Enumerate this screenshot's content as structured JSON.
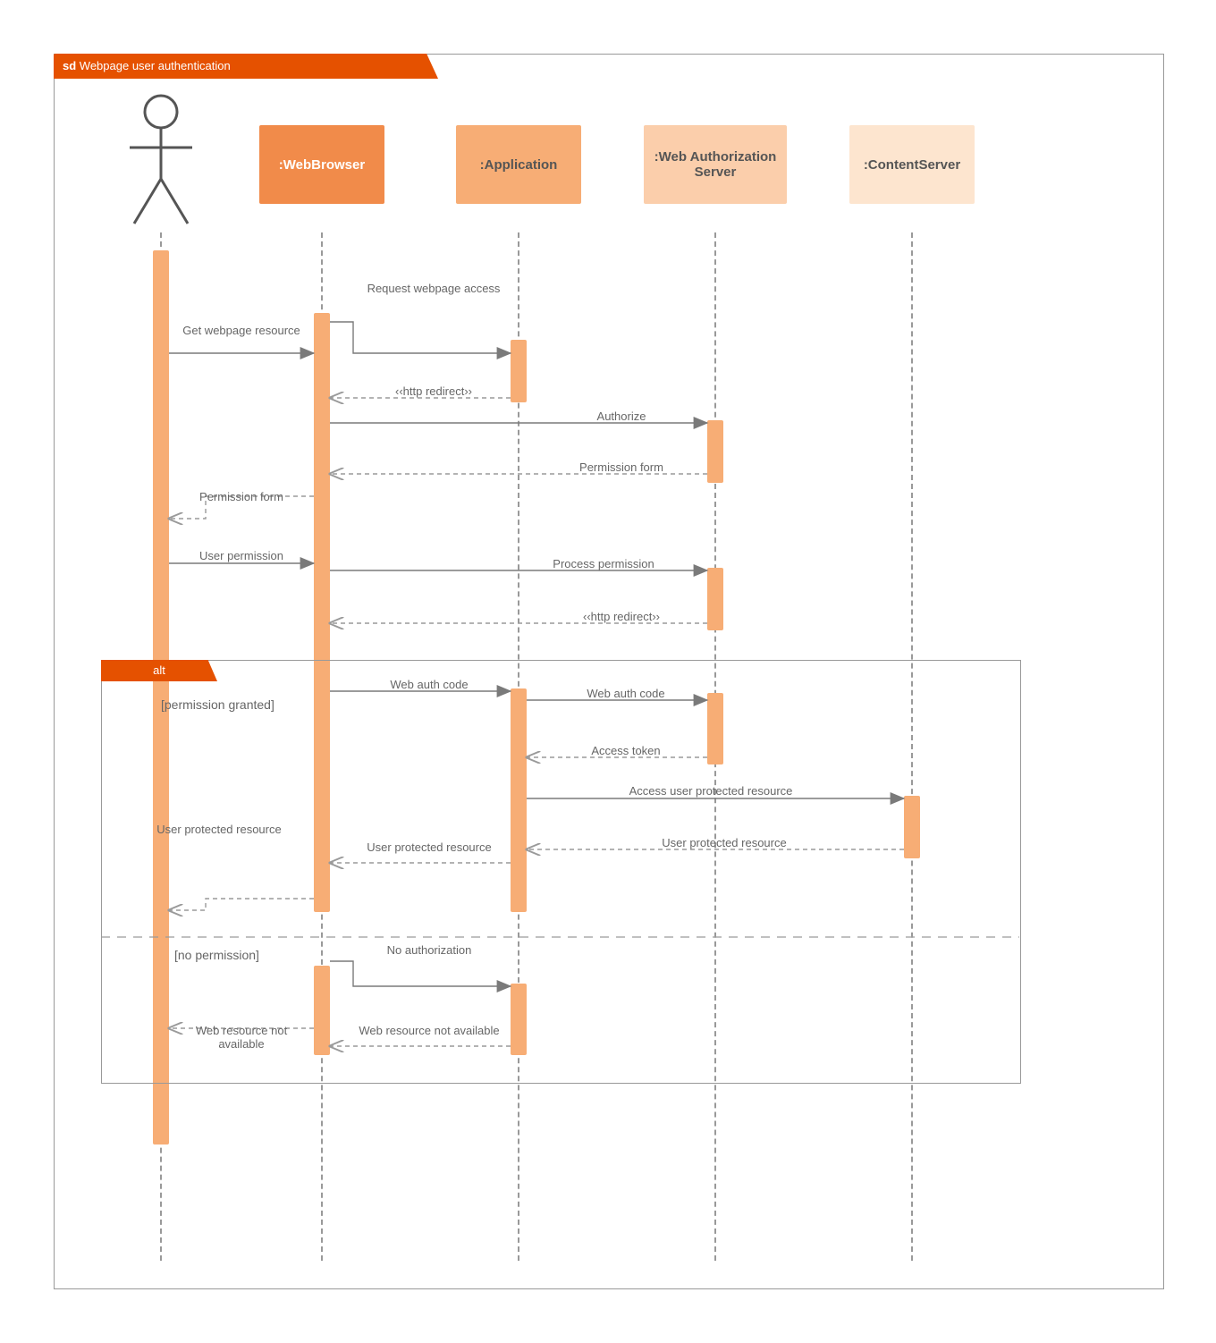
{
  "frame": {
    "stereo": "sd",
    "title": "Webpage user authentication"
  },
  "participants": {
    "actor": "User",
    "p1": ":WebBrowser",
    "p2": ":Application",
    "p3": ":Web Authorization Server",
    "p4": ":ContentServer"
  },
  "lifeline_x": {
    "actor": 180,
    "p1": 360,
    "p2": 580,
    "p3": 800,
    "p4": 1020
  },
  "messages": {
    "m1": {
      "from": "actor",
      "to": "p1",
      "text": "Get webpage resource",
      "type": "sync"
    },
    "m2": {
      "from": "p1",
      "to": "p2",
      "text": "Request webpage access",
      "type": "sync"
    },
    "m3": {
      "from": "p2",
      "to": "p1",
      "text": "‹‹http redirect››",
      "type": "return"
    },
    "m4": {
      "from": "p1",
      "to": "p3",
      "text": "Authorize",
      "type": "sync"
    },
    "m5": {
      "from": "p3",
      "to": "p1",
      "text": "Permission form",
      "type": "return"
    },
    "m6": {
      "from": "p1",
      "to": "actor",
      "text": "Permission form",
      "type": "return"
    },
    "m7": {
      "from": "actor",
      "to": "p1",
      "text": "User permission",
      "type": "sync"
    },
    "m8": {
      "from": "p1",
      "to": "p3",
      "text": "Process permission",
      "type": "sync"
    },
    "m9": {
      "from": "p3",
      "to": "p1",
      "text": "‹‹http redirect››",
      "type": "return"
    },
    "m10": {
      "from": "p1",
      "to": "p2",
      "text": "Web auth code",
      "type": "sync"
    },
    "m11": {
      "from": "p2",
      "to": "p3",
      "text": "Web auth code",
      "type": "sync"
    },
    "m12": {
      "from": "p3",
      "to": "p2",
      "text": "Access token",
      "type": "return"
    },
    "m13": {
      "from": "p2",
      "to": "p4",
      "text": "Access user protected resource",
      "type": "sync"
    },
    "m14": {
      "from": "p4",
      "to": "p2",
      "text": "User protected resource",
      "type": "return"
    },
    "m15": {
      "from": "p2",
      "to": "p1",
      "text": "User protected resource",
      "type": "return"
    },
    "m16": {
      "from": "p1",
      "to": "actor",
      "text": "User protected resource",
      "type": "return"
    },
    "m17": {
      "from": "p1",
      "to": "p2",
      "text": "No authorization",
      "type": "sync"
    },
    "m18": {
      "from": "p2",
      "to": "p1",
      "text": "Web resource not available",
      "type": "return"
    },
    "m19": {
      "from": "p1",
      "to": "actor",
      "text": "Web resource not available",
      "type": "return"
    }
  },
  "alt": {
    "label": "alt",
    "guard1": "[permission granted]",
    "guard2": "[no permission]"
  }
}
